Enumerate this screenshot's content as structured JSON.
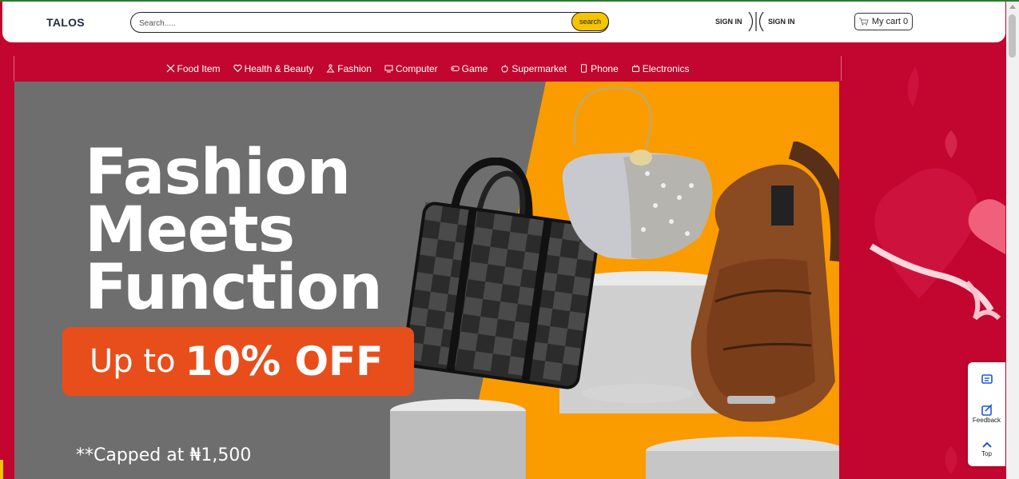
{
  "header": {
    "logo": "TALOS",
    "search_placeholder": "Search.....",
    "search_button": "search",
    "signin_1": "SIGN IN",
    "signin_2": "SIGN IN",
    "cart_label": "My cart 0"
  },
  "categories": [
    {
      "label": "Food Item",
      "icon": "fork-knife-icon"
    },
    {
      "label": "Health & Beauty",
      "icon": "heart-icon"
    },
    {
      "label": "Fashion",
      "icon": "person-icon"
    },
    {
      "label": "Computer",
      "icon": "monitor-icon"
    },
    {
      "label": "Game",
      "icon": "gamepad-icon"
    },
    {
      "label": "Supermarket",
      "icon": "apple-icon"
    },
    {
      "label": "Phone",
      "icon": "phone-icon"
    },
    {
      "label": "Electronics",
      "icon": "plug-icon"
    }
  ],
  "banner": {
    "line1": "Fashion",
    "line2": "Meets",
    "line3": "Function",
    "offer_prefix": "Up to",
    "offer_main": "10% OFF",
    "note": "**Capped at ₦1,500"
  },
  "widget": {
    "feedback": "Feedback",
    "top": "Top"
  },
  "colors": {
    "brand_red": "#c2062f",
    "accent_yellow": "#f5c400",
    "banner_orange": "#fa9b00",
    "offer_orange": "#e84e1b"
  }
}
